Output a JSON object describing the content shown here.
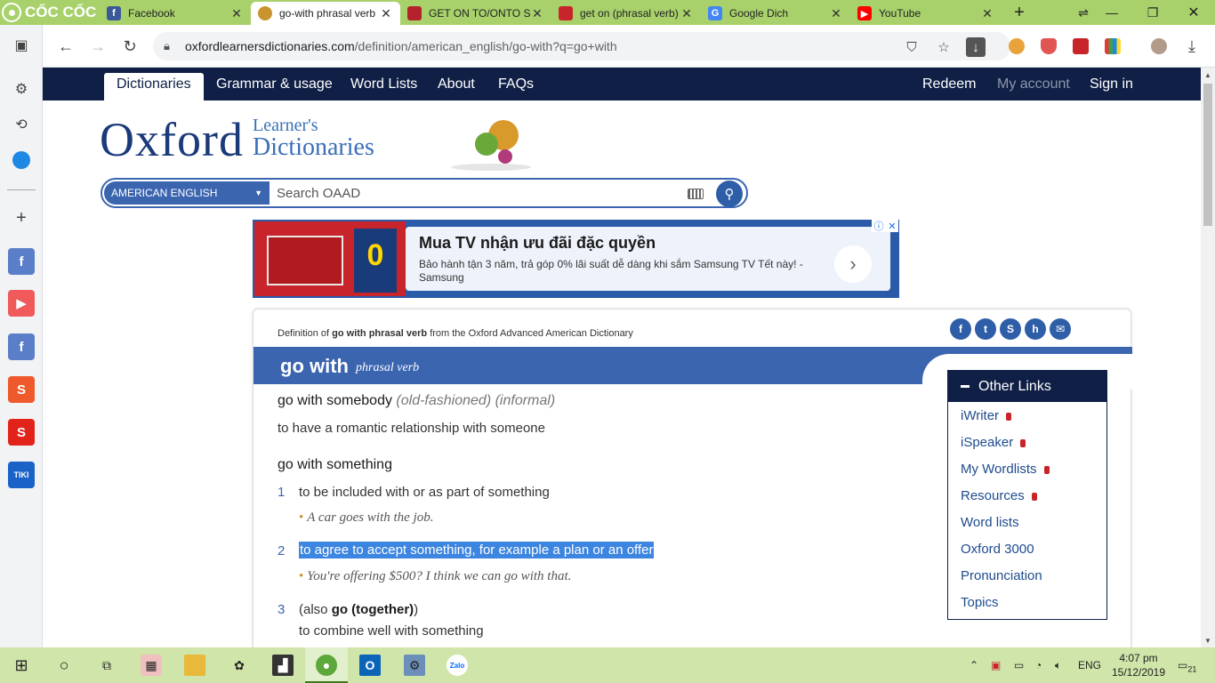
{
  "browser": {
    "brand": "CỐC CỐC",
    "tabs": [
      {
        "title": "Facebook",
        "favicon": "facebook-icon",
        "color": "#3b5998",
        "active": false
      },
      {
        "title": "go-with phrasal verb",
        "favicon": "oxford-icon",
        "color": "#c9932e",
        "active": true
      },
      {
        "title": "GET ON TO/ONTO ST",
        "favicon": "cambridge-icon",
        "color": "#b5222b",
        "active": false
      },
      {
        "title": "get on (phrasal verb)",
        "favicon": "macmillan-icon",
        "color": "#c8242b",
        "active": false
      },
      {
        "title": "Google Dich",
        "favicon": "google-translate-icon",
        "color": "#4285f4",
        "active": false
      },
      {
        "title": "YouTube",
        "favicon": "youtube-icon",
        "color": "#ff0000",
        "active": false
      }
    ],
    "url_host": "oxfordlearnersdictionaries.com",
    "url_path": "/definition/american_english/go-with?q=go+with"
  },
  "site": {
    "nav": [
      "Dictionaries",
      "Grammar & usage",
      "Word Lists",
      "About",
      "FAQs"
    ],
    "nav_right": [
      "Redeem",
      "My account",
      "Sign in"
    ],
    "logo_oxford": "Oxford",
    "logo_learners": "Learner's",
    "logo_dictionaries": "Dictionaries",
    "search_dict": "AMERICAN ENGLISH",
    "search_placeholder": "Search OAAD"
  },
  "ad": {
    "title": "Mua TV nhận ưu đãi đặc quyền",
    "desc": "Bảo hành tận 3 năm, trả góp 0% lãi suất dễ dàng khi sắm Samsung TV Tết này! - Samsung",
    "big": "0"
  },
  "entry": {
    "source_prefix": "Definition of",
    "source_word": "go with phrasal verb",
    "source_suffix": "from the Oxford Advanced American Dictionary",
    "headword": "go with",
    "pos": "phrasal verb",
    "sense1_head": "go with somebody",
    "sense1_labels": "(old-fashioned) (informal)",
    "sense1_def": "to have a romantic relationship with someone",
    "sense2_head": "go with something",
    "defs": [
      {
        "n": "1",
        "text": "to be included with or as part of something",
        "example": "A car goes with the job."
      },
      {
        "n": "2",
        "text": "to agree to accept something, for example a plan or an offer",
        "example": "You're offering $500? I think we can go with that."
      },
      {
        "n": "3",
        "also_prefix": "(also",
        "also_word": "go (together)",
        "also_suffix": ")",
        "text": "to combine well with something"
      }
    ]
  },
  "other_links": {
    "title": "Other Links",
    "items": [
      {
        "label": "iWriter",
        "locked": true
      },
      {
        "label": "iSpeaker",
        "locked": true
      },
      {
        "label": "My Wordlists",
        "locked": true
      },
      {
        "label": "Resources",
        "locked": true
      },
      {
        "label": "Word lists",
        "locked": false
      },
      {
        "label": "Oxford 3000",
        "locked": false
      },
      {
        "label": "Pronunciation",
        "locked": false
      },
      {
        "label": "Topics",
        "locked": false
      }
    ]
  },
  "taskbar": {
    "lang": "ENG",
    "time": "4:07 pm",
    "date": "15/12/2019",
    "notif": "21"
  }
}
